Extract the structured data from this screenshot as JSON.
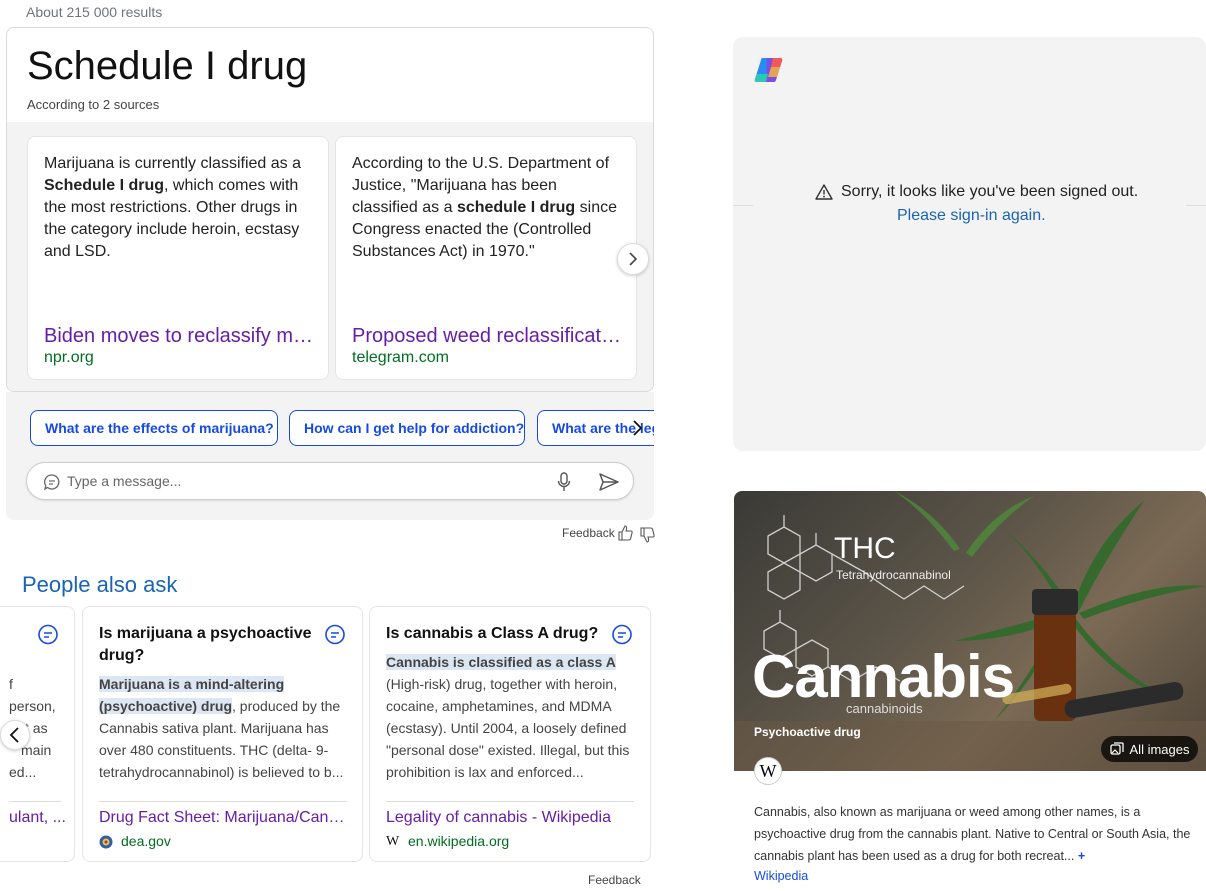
{
  "results_count": "About 215 000 results",
  "answer": {
    "title": "Schedule I drug",
    "subtitle": "According to 2 sources",
    "sources": [
      {
        "text_before": "Marijuana is currently classified as a ",
        "text_bold": "Schedule I drug",
        "text_after": ", which comes with the most restrictions. Other drugs in the category include heroin, ecstasy and LSD.",
        "link": "Biden moves to reclassify marijuana",
        "domain": "npr.org"
      },
      {
        "text_before": "According to the U.S. Department of Justice, \"Marijuana has been classified as a ",
        "text_bold": "schedule I drug",
        "text_after": " since Congress enacted the (Controlled Substances Act) in 1970.\"",
        "link": "Proposed weed reclassification",
        "domain": "telegram.com"
      }
    ]
  },
  "suggestions": [
    "What are the effects of marijuana?",
    "How can I get help for addiction?",
    "What are the legal"
  ],
  "chat": {
    "placeholder": "Type a message..."
  },
  "feedback_label": "Feedback",
  "people_also_ask": {
    "title": "People also ask",
    "partial_left_lines": [
      "f",
      "person,",
      "t as",
      "main",
      "ed..."
    ],
    "partial_left_link": "ulant, ...",
    "cards": [
      {
        "question": "Is marijuana a psychoactive drug?",
        "highlight": "Marijuana is a mind-altering (psychoactive) drug",
        "answer": ", produced by the Cannabis sativa plant. Marijuana has over 480 constituents. THC (delta- 9-tetrahydrocannabinol) is believed to b...",
        "link": "Drug Fact Sheet: Marijuana/Cannabis",
        "domain": "dea.gov"
      },
      {
        "question": "Is cannabis a Class A drug?",
        "highlight": "Cannabis is classified as a class A",
        "answer": " (High-risk) drug, together with heroin, cocaine, amphetamines, and MDMA (ecstasy). Until 2004, a loosely defined \"personal dose\" existed. Illegal, but this prohibition is lax and enforced...",
        "link": "Legality of cannabis - Wikipedia",
        "domain": "en.wikipedia.org"
      }
    ]
  },
  "copilot": {
    "signout_message": "Sorry, it looks like you've been signed out.",
    "signin_link": "Please sign-in again."
  },
  "knowledge": {
    "image_thc": "THC",
    "image_thc_sub": "Tetrahydrocannabinol",
    "name": "Cannabis",
    "image_cannabinoids": "cannabinoids",
    "type": "Psychoactive drug",
    "all_images": "All images",
    "wiki_glyph": "W",
    "description": "Cannabis, also known as marijuana or weed among other names, is a psychoactive drug from the cannabis plant. Native to Central or South Asia, the cannabis plant has been used as a drug for both recreat...",
    "more": "+",
    "source": "Wikipedia"
  },
  "colors": {
    "accent": "#174ae4",
    "link_visited": "#681da8",
    "domain_green": "#006d21",
    "panel_bg": "#f3f3f3",
    "paa_title": "#1a64b4"
  }
}
